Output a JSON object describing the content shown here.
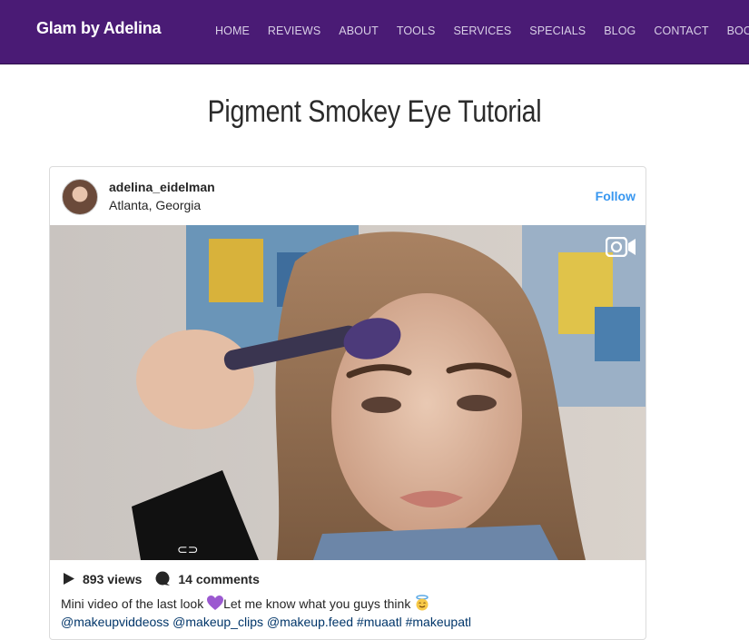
{
  "site": {
    "brand": "Glam by Adelina"
  },
  "nav": {
    "items": [
      "HOME",
      "REVIEWS",
      "ABOUT",
      "TOOLS",
      "SERVICES",
      "SPECIALS",
      "BLOG",
      "CONTACT",
      "BOOKING"
    ]
  },
  "page": {
    "title": "Pigment Smokey Eye Tutorial"
  },
  "post": {
    "username": "adelina_eidelman",
    "location": "Atlanta, Georgia",
    "follow_label": "Follow",
    "views": "893 views",
    "comments": "14 comments",
    "caption_before": "Mini video of the last look ",
    "caption_after": "Let me know what you guys think ",
    "tags": "@makeupviddeoss @makeup_clips @makeup.feed #muaatl #makeupatl",
    "media_icon": "video-camera-icon"
  },
  "colors": {
    "header_bg": "#4a1b75",
    "link_blue": "#3897f0"
  }
}
